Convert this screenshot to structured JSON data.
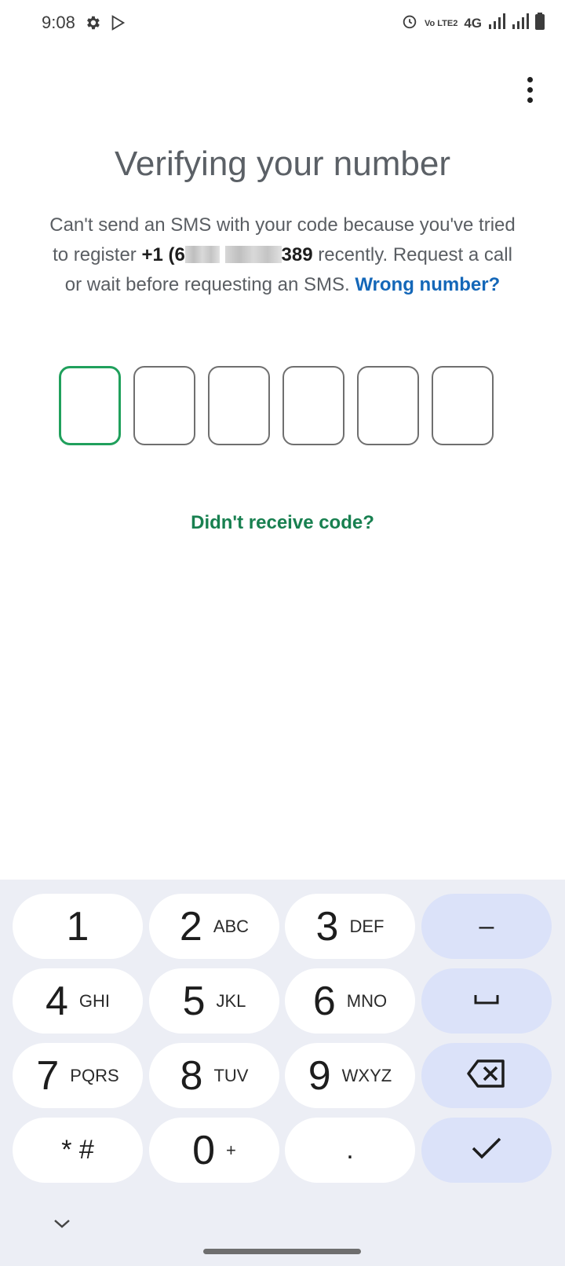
{
  "status_bar": {
    "time": "9:08",
    "network": "4G",
    "volte": "Vo LTE2",
    "left_icons": [
      "gear-icon",
      "play-store-icon"
    ],
    "right_icons": [
      "alarm-icon",
      "volte-icon",
      "signal-icon",
      "signal-icon",
      "battery-icon"
    ]
  },
  "header": {
    "menu_icon": "more-vert-icon"
  },
  "main": {
    "title": "Verifying your number",
    "desc_pre": "Can't send an SMS with your code because you've tried to register ",
    "phone_start": "+1 (6",
    "phone_end": "389",
    "desc_post": " recently. Request a call or wait before requesting an SMS. ",
    "wrong_number": "Wrong number?",
    "code_digits": 6,
    "resend_label": "Didn't receive code?"
  },
  "keypad": {
    "keys": [
      {
        "num": "1",
        "letters": ""
      },
      {
        "num": "2",
        "letters": "ABC"
      },
      {
        "num": "3",
        "letters": "DEF"
      },
      {
        "num": "4",
        "letters": "GHI"
      },
      {
        "num": "5",
        "letters": "JKL"
      },
      {
        "num": "6",
        "letters": "MNO"
      },
      {
        "num": "7",
        "letters": "PQRS"
      },
      {
        "num": "8",
        "letters": "TUV"
      },
      {
        "num": "9",
        "letters": "WXYZ"
      },
      {
        "num": "* #",
        "letters": ""
      },
      {
        "num": "0",
        "letters": "+"
      },
      {
        "num": ".",
        "letters": ""
      }
    ],
    "dash": "–",
    "action_icons": [
      "dash-key",
      "space-key-icon",
      "backspace-icon",
      "check-icon"
    ],
    "collapse_icon": "chevron-down-icon"
  },
  "colors": {
    "accent": "#20a05c",
    "link": "#1467b8",
    "keypad_bg": "#eceef5",
    "action_key": "#dbe2f9"
  }
}
